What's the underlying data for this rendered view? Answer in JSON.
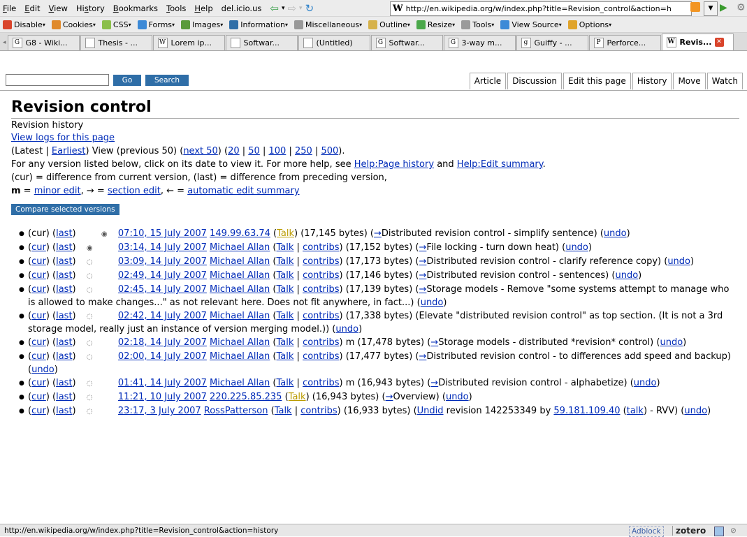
{
  "menubar": {
    "items": [
      "File",
      "Edit",
      "View",
      "History",
      "Bookmarks",
      "Tools",
      "Help",
      "del.icio.us"
    ],
    "url": "http://en.wikipedia.org/w/index.php?title=Revision_control&action=h"
  },
  "devbar": {
    "items": [
      {
        "label": "Disable",
        "icon": "disable-icon",
        "color": "#d9442b"
      },
      {
        "label": "Cookies",
        "icon": "cookies-icon",
        "color": "#e08a2b"
      },
      {
        "label": "CSS",
        "icon": "css-icon",
        "color": "#8bbf4a"
      },
      {
        "label": "Forms",
        "icon": "forms-icon",
        "color": "#3d8ad7"
      },
      {
        "label": "Images",
        "icon": "images-icon",
        "color": "#5a9a3a"
      },
      {
        "label": "Information",
        "icon": "information-icon",
        "color": "#2f6ea7"
      },
      {
        "label": "Miscellaneous",
        "icon": "miscellaneous-icon",
        "color": "#999999"
      },
      {
        "label": "Outline",
        "icon": "outline-icon",
        "color": "#d6b24a"
      },
      {
        "label": "Resize",
        "icon": "resize-icon",
        "color": "#4aa84a"
      },
      {
        "label": "Tools",
        "icon": "tools-icon",
        "color": "#9a9a9a"
      },
      {
        "label": "View Source",
        "icon": "view-source-icon",
        "color": "#3d8ad7"
      },
      {
        "label": "Options",
        "icon": "options-icon",
        "color": "#e0a42b"
      }
    ]
  },
  "tabs": [
    {
      "label": "G8 - Wiki...",
      "icon": "G"
    },
    {
      "label": "Thesis - ...",
      "icon": ""
    },
    {
      "label": "Lorem ip...",
      "icon": "W"
    },
    {
      "label": "Softwar...",
      "icon": ""
    },
    {
      "label": "(Untitled)",
      "icon": ""
    },
    {
      "label": "Softwar...",
      "icon": "G"
    },
    {
      "label": "3-way m...",
      "icon": "G"
    },
    {
      "label": "Guiffy - ...",
      "icon": "g"
    },
    {
      "label": "Perforce...",
      "icon": "P"
    },
    {
      "label": "Revis...",
      "icon": "W",
      "active": true
    }
  ],
  "search": {
    "go": "Go",
    "search": "Search"
  },
  "page_tabs": [
    "Article",
    "Discussion",
    "Edit this page",
    "History",
    "Move",
    "Watch"
  ],
  "title": "Revision control",
  "subtitle": "Revision history",
  "view_logs": "View logs for this page",
  "nav": {
    "latest": "(Latest | ",
    "earliest": "Earliest",
    "view_prev": ") View (previous 50) (",
    "next": "next 50",
    "sep1": ") (",
    "n20": "20",
    "n50": "50",
    "n100": "100",
    "n250": "250",
    "n500": "500",
    "end": ")."
  },
  "help": {
    "pre": "For any version listed below, click on its date to view it. For more help, see ",
    "page_history": "Help:Page history",
    "and": " and ",
    "edit_summary": "Help:Edit summary",
    "end": "."
  },
  "legend1": "(cur) = difference from current version, (last) = difference from preceding version,",
  "legend2": {
    "m": "m",
    "eq1": " = ",
    "minor": "minor edit",
    "arrow1": ", → = ",
    "section": "section edit",
    "arrow2": ", ← = ",
    "auto": "automatic edit summary"
  },
  "compare_button": "Compare selected versions",
  "status": {
    "url": "http://en.wikipedia.org/w/index.php?title=Revision_control&action=history",
    "adblock": "Adblock",
    "zotero": "zotero"
  }
}
